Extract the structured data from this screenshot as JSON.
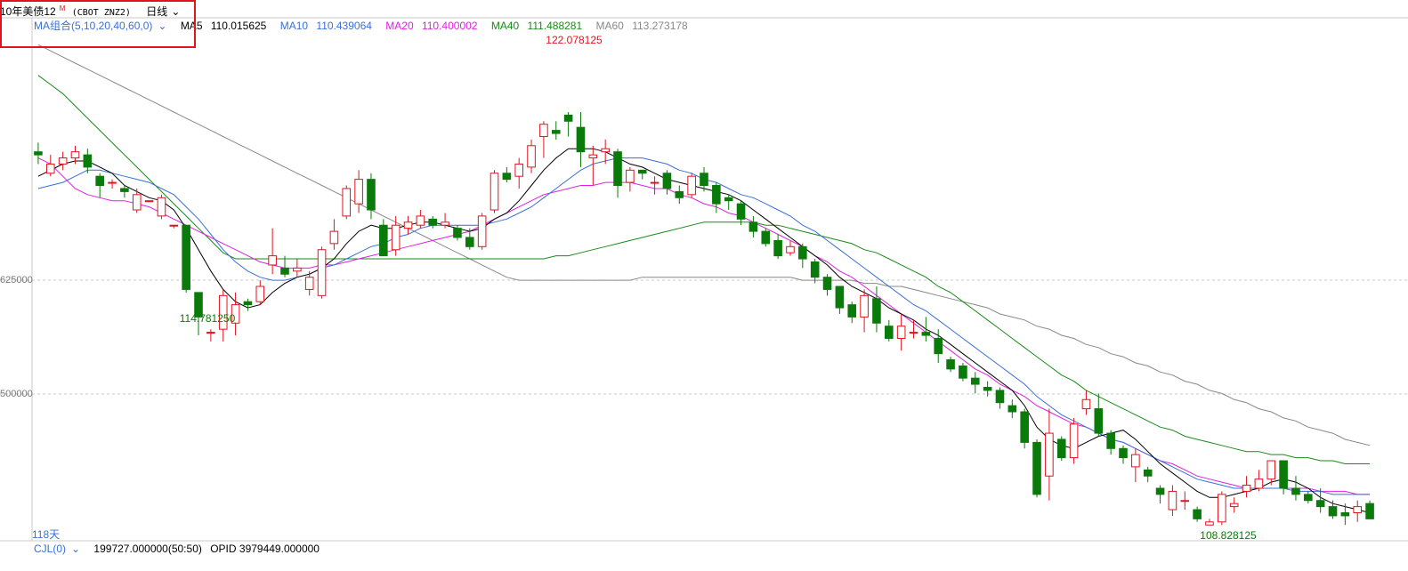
{
  "header": {
    "instrument": "10年美债12",
    "instrument_sup": "M",
    "symbol": "(CBOT ZNZ2)",
    "period": "日线",
    "period_caret": "⌄"
  },
  "ma_legend": {
    "combo_label": "MA组合(5,10,20,40,60,0)",
    "combo_caret": "⌄",
    "items": [
      {
        "label": "MA5",
        "value": "110.015625",
        "color": "#000000"
      },
      {
        "label": "MA10",
        "value": "110.439064",
        "color": "#3a6fd8"
      },
      {
        "label": "MA20",
        "value": "110.400002",
        "color": "#e020e0"
      },
      {
        "label": "MA40",
        "value": "111.488281",
        "color": "#1a8a1a"
      },
      {
        "label": "MA60",
        "value": "113.273178",
        "color": "#888888"
      }
    ]
  },
  "axis": {
    "y_tick_1": "625000",
    "y_tick_2": "500000",
    "days_label": "118天"
  },
  "annotations": {
    "high": "122.078125",
    "low1": "114.781250",
    "low2": "108.828125"
  },
  "volume_bar": {
    "indicator": "CJL(0)",
    "indicator_caret": "⌄",
    "volume_text": "199727.000000(50:50)",
    "opid_text": "OPID 3979449.000000"
  },
  "colors": {
    "up": "#e0141e",
    "down": "#0a7a0a",
    "grid": "#c8c8c8"
  },
  "chart_data": {
    "type": "candlestick",
    "title": "10年美债12M (CBOT ZNZ2) 日线",
    "ohlc": [
      [
        121.0,
        121.3,
        120.6,
        120.9
      ],
      [
        120.3,
        120.9,
        120.2,
        120.6
      ],
      [
        120.6,
        121.0,
        120.4,
        120.8
      ],
      [
        120.8,
        121.2,
        120.6,
        121.0
      ],
      [
        120.9,
        121.1,
        120.3,
        120.5
      ],
      [
        120.2,
        120.3,
        119.5,
        119.9
      ],
      [
        120.0,
        120.1,
        119.8,
        120.0
      ],
      [
        119.8,
        119.9,
        119.5,
        119.7
      ],
      [
        119.1,
        119.8,
        119.0,
        119.6
      ],
      [
        119.4,
        119.4,
        119.4,
        119.4
      ],
      [
        118.9,
        119.6,
        118.8,
        119.5
      ],
      [
        118.6,
        118.6,
        118.5,
        118.6
      ],
      [
        118.6,
        118.6,
        116.4,
        116.5
      ],
      [
        116.4,
        116.4,
        115.0,
        115.6
      ],
      [
        115.1,
        115.2,
        114.8,
        115.1
      ],
      [
        115.2,
        116.5,
        114.8,
        116.3
      ],
      [
        115.4,
        116.4,
        115.0,
        116.0
      ],
      [
        116.1,
        116.2,
        115.8,
        116.0
      ],
      [
        116.1,
        116.8,
        116.0,
        116.6
      ],
      [
        117.3,
        118.5,
        117.0,
        117.6
      ],
      [
        117.2,
        117.6,
        116.9,
        117.0
      ],
      [
        117.1,
        117.5,
        116.9,
        117.2
      ],
      [
        116.5,
        117.1,
        116.3,
        116.9
      ],
      [
        116.3,
        117.9,
        116.2,
        117.8
      ],
      [
        118.0,
        118.8,
        117.8,
        118.4
      ],
      [
        118.9,
        119.9,
        118.8,
        119.8
      ],
      [
        119.3,
        120.4,
        119.0,
        120.1
      ],
      [
        120.1,
        120.3,
        118.8,
        119.1
      ],
      [
        118.6,
        118.8,
        117.6,
        117.6
      ],
      [
        117.8,
        118.9,
        117.6,
        118.6
      ],
      [
        118.5,
        118.9,
        118.3,
        118.7
      ],
      [
        118.6,
        119.1,
        118.5,
        118.9
      ],
      [
        118.8,
        118.9,
        118.5,
        118.6
      ],
      [
        118.6,
        119.0,
        118.5,
        118.7
      ],
      [
        118.5,
        118.6,
        118.1,
        118.2
      ],
      [
        118.2,
        118.5,
        117.8,
        117.9
      ],
      [
        117.9,
        119.0,
        117.8,
        118.9
      ],
      [
        119.1,
        120.4,
        119.0,
        120.3
      ],
      [
        120.3,
        120.5,
        120.0,
        120.1
      ],
      [
        120.2,
        120.8,
        119.8,
        120.6
      ],
      [
        120.5,
        121.4,
        120.3,
        121.2
      ],
      [
        121.5,
        122.0,
        120.8,
        121.9
      ],
      [
        121.7,
        122.0,
        121.4,
        121.6
      ],
      [
        122.2,
        122.3,
        121.5,
        122.0
      ],
      [
        121.8,
        122.3,
        120.5,
        121.0
      ],
      [
        120.8,
        121.2,
        119.9,
        120.9
      ],
      [
        121.0,
        121.4,
        120.6,
        121.1
      ],
      [
        121.0,
        121.1,
        119.5,
        119.9
      ],
      [
        120.0,
        120.5,
        119.7,
        120.4
      ],
      [
        120.4,
        120.4,
        120.1,
        120.3
      ],
      [
        120.0,
        120.2,
        119.6,
        120.0
      ],
      [
        120.3,
        120.4,
        119.6,
        119.8
      ],
      [
        119.7,
        119.9,
        119.3,
        119.5
      ],
      [
        119.6,
        120.3,
        119.5,
        120.2
      ],
      [
        120.3,
        120.5,
        119.7,
        119.9
      ],
      [
        119.9,
        120.0,
        119.0,
        119.3
      ],
      [
        119.5,
        119.6,
        119.1,
        119.4
      ],
      [
        119.3,
        119.4,
        118.6,
        118.8
      ],
      [
        118.7,
        118.9,
        118.2,
        118.4
      ],
      [
        118.4,
        118.5,
        117.9,
        118.0
      ],
      [
        118.1,
        118.3,
        117.5,
        117.6
      ],
      [
        117.7,
        118.1,
        117.6,
        117.9
      ],
      [
        117.9,
        118.0,
        117.2,
        117.5
      ],
      [
        117.4,
        117.5,
        116.7,
        116.9
      ],
      [
        116.9,
        117.0,
        116.3,
        116.5
      ],
      [
        116.6,
        116.6,
        115.7,
        115.9
      ],
      [
        116.0,
        116.1,
        115.4,
        115.6
      ],
      [
        115.6,
        116.5,
        115.1,
        116.3
      ],
      [
        116.2,
        116.6,
        115.1,
        115.4
      ],
      [
        115.3,
        115.5,
        114.8,
        114.9
      ],
      [
        114.9,
        115.7,
        114.5,
        115.3
      ],
      [
        115.1,
        115.5,
        114.9,
        115.1
      ],
      [
        115.1,
        115.6,
        114.8,
        115.0
      ],
      [
        114.9,
        115.2,
        114.1,
        114.4
      ],
      [
        114.2,
        114.3,
        113.8,
        113.9
      ],
      [
        114.0,
        114.1,
        113.5,
        113.6
      ],
      [
        113.6,
        113.8,
        113.1,
        113.4
      ],
      [
        113.3,
        113.5,
        113.0,
        113.2
      ],
      [
        113.2,
        113.3,
        112.6,
        112.8
      ],
      [
        112.7,
        112.9,
        112.3,
        112.5
      ],
      [
        112.5,
        112.6,
        111.3,
        111.5
      ],
      [
        111.5,
        111.6,
        109.7,
        109.8
      ],
      [
        110.4,
        112.6,
        109.6,
        111.8
      ],
      [
        111.6,
        111.7,
        110.9,
        111.0
      ],
      [
        111.0,
        112.3,
        110.8,
        112.1
      ],
      [
        112.6,
        113.2,
        112.4,
        112.9
      ],
      [
        112.6,
        113.1,
        111.7,
        111.8
      ],
      [
        111.8,
        111.9,
        111.1,
        111.3
      ],
      [
        111.3,
        111.4,
        110.8,
        111.0
      ],
      [
        110.7,
        111.3,
        110.2,
        111.1
      ],
      [
        110.6,
        110.7,
        110.2,
        110.4
      ],
      [
        110.0,
        110.1,
        109.5,
        109.8
      ],
      [
        109.3,
        110.1,
        109.1,
        109.9
      ],
      [
        109.6,
        109.9,
        109.3,
        109.6
      ],
      [
        109.3,
        109.4,
        108.9,
        109.0
      ],
      [
        108.8,
        109.0,
        108.8,
        108.9
      ],
      [
        108.9,
        109.9,
        108.8,
        109.8
      ],
      [
        109.4,
        109.7,
        109.2,
        109.5
      ],
      [
        109.9,
        110.4,
        109.7,
        110.1
      ],
      [
        110.0,
        110.6,
        109.9,
        110.3
      ],
      [
        110.3,
        110.9,
        110.1,
        110.9
      ],
      [
        110.9,
        110.9,
        109.8,
        110.0
      ],
      [
        110.0,
        110.4,
        109.6,
        109.8
      ],
      [
        109.8,
        109.9,
        109.5,
        109.6
      ],
      [
        109.6,
        110.0,
        109.2,
        109.4
      ],
      [
        109.4,
        109.6,
        109.0,
        109.1
      ],
      [
        109.2,
        109.5,
        108.8,
        109.1
      ],
      [
        109.2,
        109.6,
        108.9,
        109.4
      ],
      [
        109.5,
        109.6,
        109.0,
        109.0
      ]
    ],
    "ma5": [
      120.2,
      120.4,
      120.6,
      120.7,
      120.7,
      120.5,
      120.3,
      119.9,
      119.7,
      119.5,
      119.4,
      119.1,
      118.5,
      117.8,
      117.1,
      116.5,
      116.1,
      115.9,
      116.0,
      116.4,
      116.7,
      116.9,
      117.0,
      117.2,
      117.5,
      118.0,
      118.4,
      118.6,
      118.5,
      118.5,
      118.6,
      118.7,
      118.7,
      118.6,
      118.5,
      118.4,
      118.5,
      118.8,
      119.0,
      119.4,
      119.9,
      120.4,
      120.8,
      121.1,
      121.1,
      121.1,
      121.0,
      120.8,
      120.6,
      120.5,
      120.3,
      120.1,
      120.0,
      119.9,
      119.8,
      119.7,
      119.6,
      119.4,
      119.1,
      118.8,
      118.5,
      118.2,
      117.9,
      117.6,
      117.3,
      116.9,
      116.6,
      116.4,
      116.2,
      115.9,
      115.7,
      115.5,
      115.2,
      115.0,
      114.7,
      114.4,
      114.1,
      113.8,
      113.5,
      113.2,
      112.7,
      112.0,
      111.6,
      111.4,
      111.3,
      111.5,
      111.7,
      111.8,
      111.9,
      111.6,
      111.2,
      110.8,
      110.5,
      110.2,
      109.9,
      109.7,
      109.7,
      109.8,
      109.9,
      110.0,
      110.2,
      110.3,
      110.2,
      110.0,
      109.7,
      109.5,
      109.4,
      109.3,
      109.2
    ],
    "ma10": [
      119.8,
      119.9,
      120.0,
      120.2,
      120.4,
      120.4,
      120.3,
      120.2,
      120.1,
      120.0,
      119.8,
      119.6,
      119.2,
      118.8,
      118.3,
      117.8,
      117.4,
      117.1,
      116.9,
      116.8,
      116.8,
      116.9,
      117.0,
      117.2,
      117.3,
      117.5,
      117.7,
      117.9,
      118.0,
      118.2,
      118.3,
      118.5,
      118.6,
      118.6,
      118.6,
      118.6,
      118.6,
      118.7,
      118.8,
      119.0,
      119.2,
      119.5,
      119.8,
      120.1,
      120.4,
      120.6,
      120.7,
      120.8,
      120.8,
      120.8,
      120.7,
      120.6,
      120.4,
      120.3,
      120.1,
      120.0,
      119.8,
      119.6,
      119.5,
      119.3,
      119.1,
      118.9,
      118.6,
      118.4,
      118.1,
      117.8,
      117.5,
      117.2,
      116.9,
      116.6,
      116.3,
      116.0,
      115.8,
      115.5,
      115.2,
      114.9,
      114.6,
      114.3,
      114.0,
      113.7,
      113.4,
      113.0,
      112.7,
      112.4,
      112.2,
      112.0,
      111.8,
      111.6,
      111.5,
      111.3,
      111.1,
      110.9,
      110.7,
      110.5,
      110.3,
      110.2,
      110.1,
      110.0,
      110.0,
      110.0,
      110.0,
      110.0,
      109.9,
      109.9,
      109.9,
      109.8,
      109.8,
      109.8,
      109.8
    ],
    "ma20": [
      120.8,
      120.6,
      120.2,
      119.8,
      119.6,
      119.5,
      119.4,
      119.4,
      119.3,
      119.2,
      119.0,
      118.8,
      118.6,
      118.4,
      118.2,
      118.0,
      117.8,
      117.6,
      117.4,
      117.3,
      117.2,
      117.2,
      117.2,
      117.3,
      117.3,
      117.4,
      117.5,
      117.6,
      117.7,
      117.8,
      117.9,
      118.0,
      118.1,
      118.2,
      118.3,
      118.4,
      118.6,
      118.8,
      119.0,
      119.2,
      119.4,
      119.6,
      119.7,
      119.8,
      119.9,
      119.9,
      120.0,
      120.0,
      120.0,
      119.9,
      119.8,
      119.8,
      119.6,
      119.5,
      119.3,
      119.2,
      119.0,
      118.9,
      118.7,
      118.5,
      118.3,
      118.1,
      117.9,
      117.6,
      117.4,
      117.1,
      116.9,
      116.6,
      116.3,
      116.0,
      115.7,
      115.4,
      115.1,
      114.8,
      114.5,
      114.2,
      113.9,
      113.7,
      113.4,
      113.2,
      113.0,
      112.7,
      112.5,
      112.3,
      112.1,
      112.0,
      111.8,
      111.6,
      111.5,
      111.3,
      111.1,
      110.9,
      110.8,
      110.6,
      110.4,
      110.3,
      110.2,
      110.1,
      110.0,
      110.0,
      110.0,
      110.0,
      110.0,
      110.0,
      109.9,
      109.9,
      109.9,
      109.8,
      109.8
    ],
    "ma40": [
      123.5,
      123.2,
      122.9,
      122.5,
      122.1,
      121.7,
      121.3,
      120.9,
      120.5,
      120.1,
      119.7,
      119.3,
      118.9,
      118.5,
      118.1,
      117.7,
      117.5,
      117.5,
      117.5,
      117.5,
      117.5,
      117.5,
      117.5,
      117.5,
      117.5,
      117.5,
      117.5,
      117.5,
      117.5,
      117.5,
      117.5,
      117.5,
      117.5,
      117.5,
      117.5,
      117.5,
      117.5,
      117.5,
      117.5,
      117.5,
      117.5,
      117.5,
      117.6,
      117.6,
      117.7,
      117.8,
      117.9,
      118.0,
      118.1,
      118.2,
      118.3,
      118.4,
      118.5,
      118.6,
      118.7,
      118.7,
      118.7,
      118.7,
      118.7,
      118.6,
      118.6,
      118.5,
      118.4,
      118.3,
      118.2,
      118.1,
      118.0,
      117.8,
      117.7,
      117.5,
      117.3,
      117.1,
      116.9,
      116.6,
      116.4,
      116.1,
      115.8,
      115.5,
      115.2,
      114.9,
      114.6,
      114.3,
      114.0,
      113.7,
      113.5,
      113.2,
      113.0,
      112.8,
      112.6,
      112.4,
      112.2,
      112.0,
      111.9,
      111.7,
      111.6,
      111.5,
      111.4,
      111.3,
      111.2,
      111.2,
      111.1,
      111.1,
      111.0,
      111.0,
      110.9,
      110.9,
      110.8,
      110.8,
      110.8
    ],
    "ma60": [
      124.5,
      124.3,
      124.1,
      123.9,
      123.7,
      123.5,
      123.3,
      123.1,
      122.9,
      122.7,
      122.5,
      122.3,
      122.1,
      121.9,
      121.7,
      121.5,
      121.3,
      121.1,
      120.9,
      120.7,
      120.5,
      120.3,
      120.1,
      119.9,
      119.7,
      119.5,
      119.3,
      119.1,
      118.9,
      118.7,
      118.5,
      118.3,
      118.1,
      117.9,
      117.7,
      117.5,
      117.3,
      117.1,
      116.9,
      116.8,
      116.8,
      116.8,
      116.8,
      116.8,
      116.8,
      116.8,
      116.8,
      116.8,
      116.8,
      116.9,
      116.9,
      116.9,
      116.9,
      116.9,
      116.9,
      116.9,
      116.9,
      116.9,
      116.9,
      116.9,
      116.9,
      116.9,
      116.8,
      116.8,
      116.8,
      116.8,
      116.8,
      116.7,
      116.7,
      116.6,
      116.6,
      116.5,
      116.4,
      116.3,
      116.2,
      116.1,
      116.0,
      115.9,
      115.7,
      115.6,
      115.5,
      115.3,
      115.2,
      115.0,
      114.9,
      114.7,
      114.6,
      114.4,
      114.3,
      114.1,
      114.0,
      113.8,
      113.7,
      113.5,
      113.4,
      113.2,
      113.1,
      112.9,
      112.8,
      112.6,
      112.5,
      112.3,
      112.2,
      112.0,
      111.9,
      111.8,
      111.6,
      111.5,
      111.4
    ],
    "ylim": [
      108.4,
      124.8
    ],
    "grid": true
  }
}
